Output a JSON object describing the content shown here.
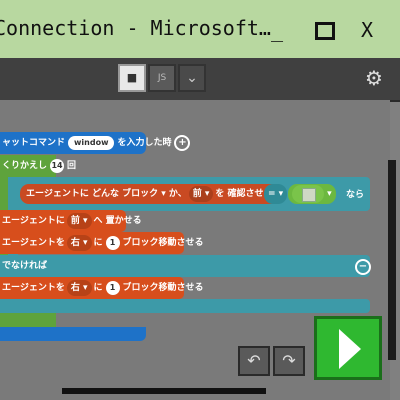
{
  "window": {
    "title": "Connection - Microsoft…",
    "min": "_",
    "close": "X"
  },
  "toolbar": {
    "js_label": "JS",
    "blocks_icon": "puzzle-icon",
    "dropdown_icon": "chevron-down-icon",
    "settings_icon": "gear-icon"
  },
  "blocks": {
    "chat_cmd": {
      "prefix": "ャットコマンド",
      "value": "window",
      "suffix": "を入力した時"
    },
    "repeat": {
      "prefix": "くりかえし",
      "count": "14",
      "suffix": "回"
    },
    "if": {
      "inspect": "エージェントに どんな ブロック",
      "ka": "か、",
      "dir": "前",
      "check": "を 確認させる",
      "eq": "=",
      "then": "なら"
    },
    "place": {
      "prefix": "エージェントに",
      "dir": "前",
      "suffix": "へ 置かせる"
    },
    "move1": {
      "prefix": "エージェントを",
      "dir": "右",
      "ni": "に",
      "count": "1",
      "suffix": "ブロック移動させる"
    },
    "else": {
      "label": "でなければ"
    },
    "move2": {
      "prefix": "エージェントを",
      "dir": "右",
      "ni": "に",
      "count": "1",
      "suffix": "ブロック移動させる"
    }
  },
  "controls": {
    "undo": "↶",
    "redo": "↷"
  },
  "colors": {
    "event": "#1e72c8",
    "loop": "#5ea33c",
    "logic": "#3d9aa8",
    "agent": "#d74e1c",
    "run": "#2fb830"
  }
}
